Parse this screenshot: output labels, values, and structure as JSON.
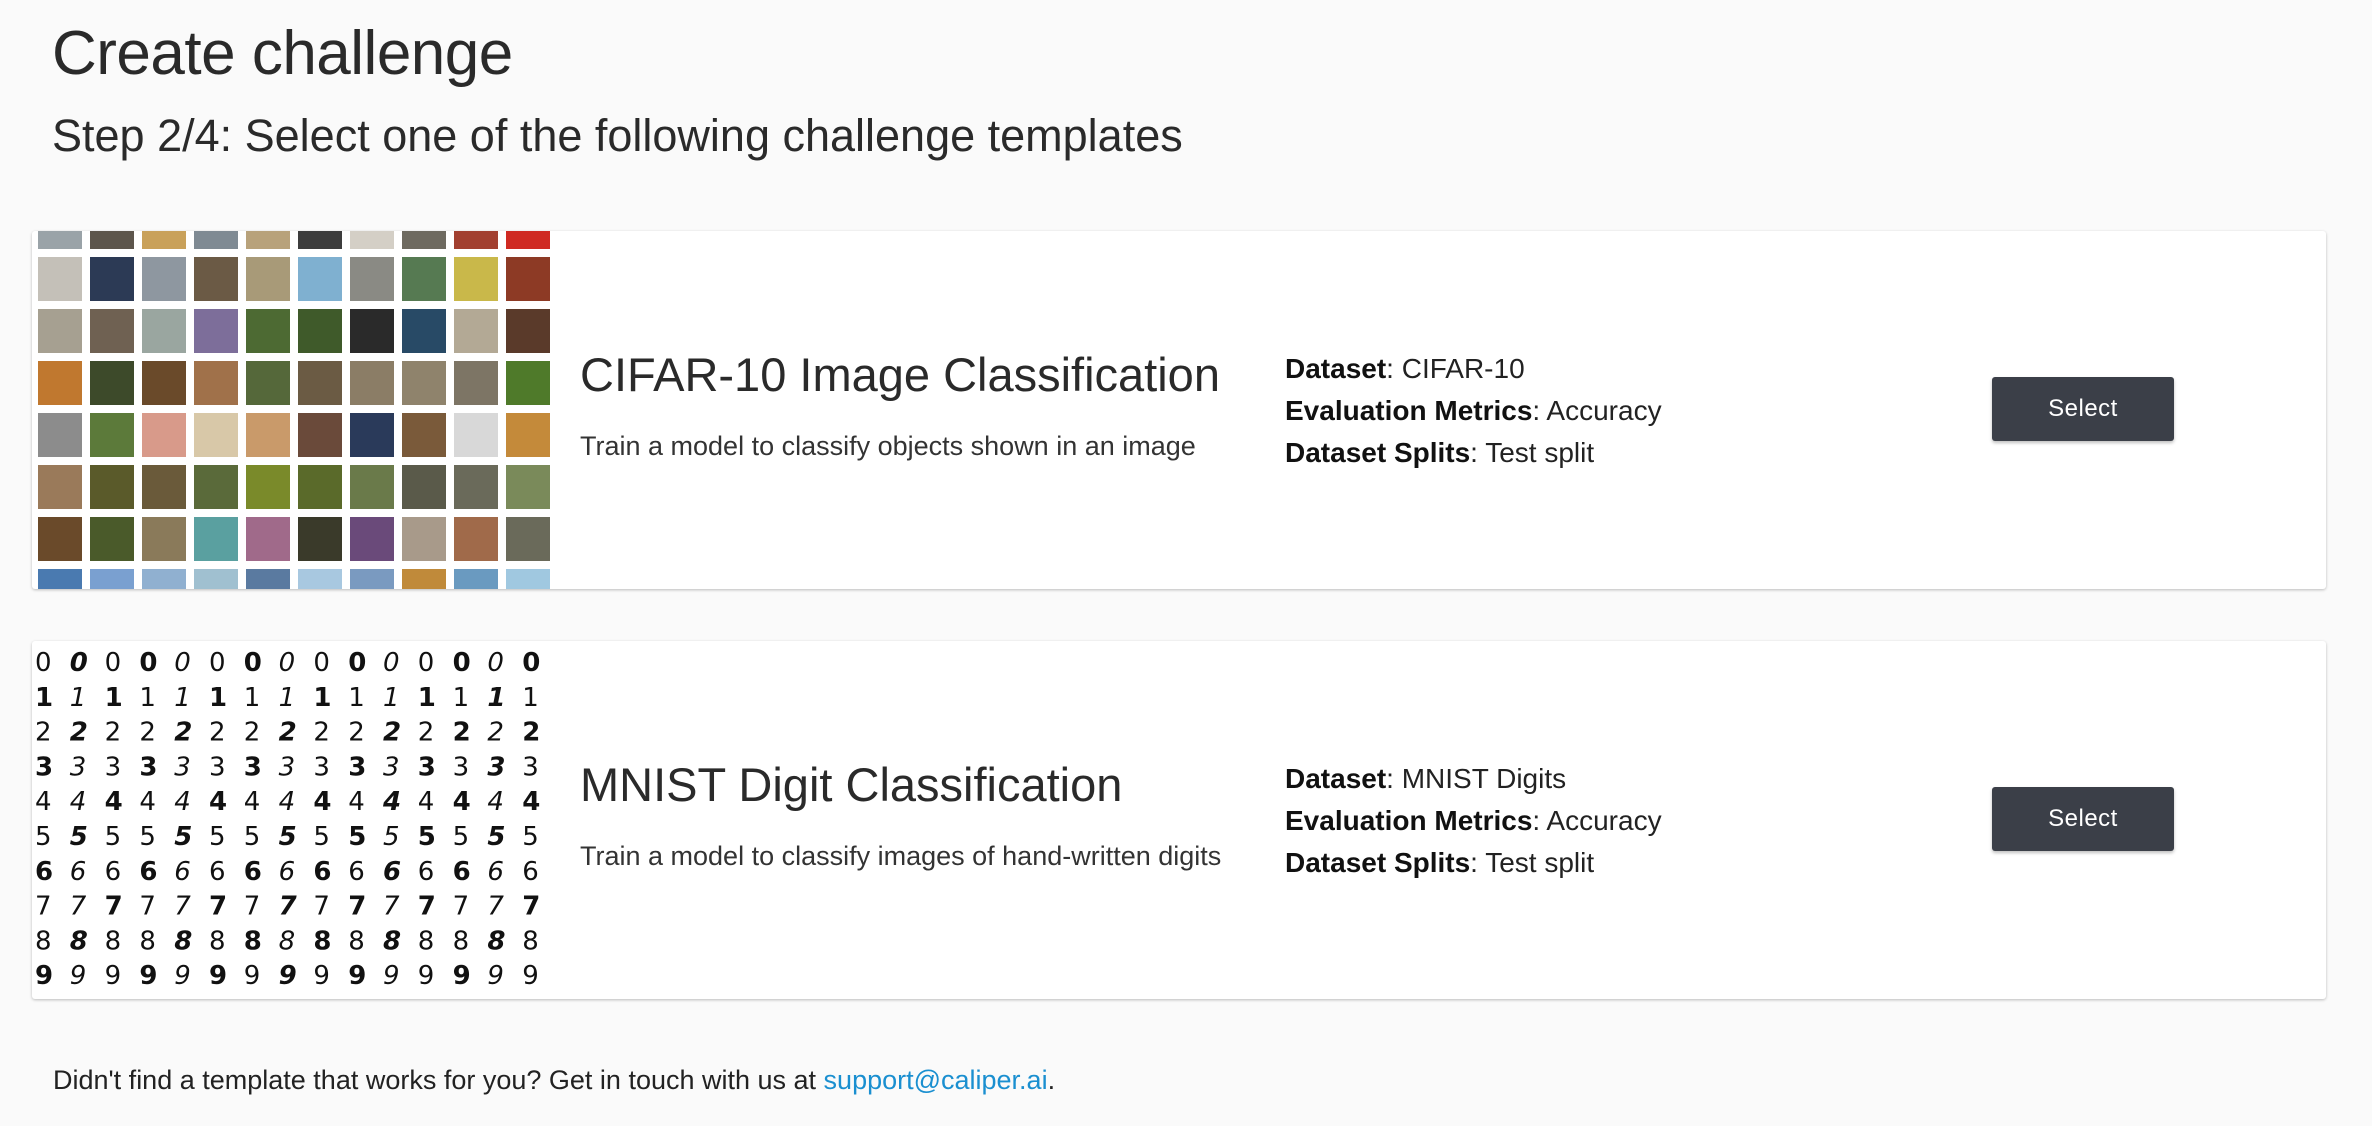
{
  "header": {
    "title": "Create challenge",
    "step": "Step 2/4: Select one of the following challenge templates"
  },
  "templates": [
    {
      "title": "CIFAR-10 Image Classification",
      "description": "Train a model to classify objects shown in an image",
      "thumbnail": "cifar-10-sample-grid",
      "meta": [
        {
          "key": "Dataset",
          "value": ": CIFAR-10"
        },
        {
          "key": "Evaluation Metrics",
          "value": ": Accuracy"
        },
        {
          "key": "Dataset Splits",
          "value": ": Test split"
        }
      ],
      "button_label": "Select"
    },
    {
      "title": "MNIST Digit Classification",
      "description": "Train a model to classify images of hand-written digits",
      "thumbnail": "mnist-digit-sample-grid",
      "digits": [
        "0",
        "1",
        "2",
        "3",
        "4",
        "5",
        "6",
        "7",
        "8",
        "9"
      ],
      "meta": [
        {
          "key": "Dataset",
          "value": ": MNIST Digits"
        },
        {
          "key": "Evaluation Metrics",
          "value": ": Accuracy"
        },
        {
          "key": "Dataset Splits",
          "value": ": Test split"
        }
      ],
      "button_label": "Select"
    }
  ],
  "footer": {
    "text": "Didn't find a template that works for you? Get in touch with us at ",
    "link": "support@caliper.ai",
    "end": "."
  },
  "colors": {
    "button": "#3b3f48",
    "link": "#1a8fd0",
    "background": "#fafafa"
  }
}
